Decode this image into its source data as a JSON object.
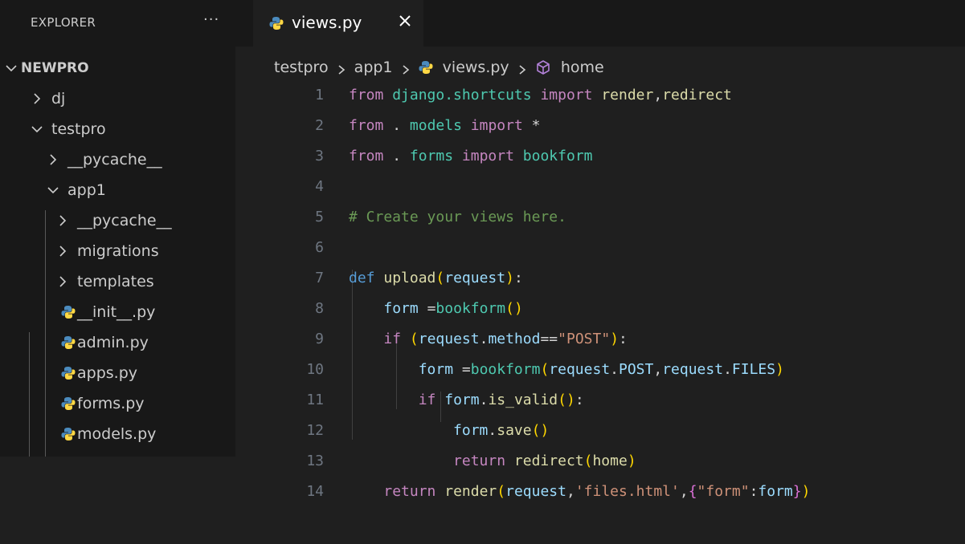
{
  "explorer": {
    "title": "EXPLORER",
    "more": "···",
    "tree": [
      {
        "label": "NEWPRO",
        "kind": "root",
        "expanded": true
      },
      {
        "label": "dj",
        "kind": "folder",
        "expanded": false
      },
      {
        "label": "testpro",
        "kind": "folder",
        "expanded": true
      },
      {
        "label": "__pycache__",
        "kind": "folder",
        "expanded": false
      },
      {
        "label": "app1",
        "kind": "folder",
        "expanded": true
      },
      {
        "label": "__pycache__",
        "kind": "folder",
        "expanded": false
      },
      {
        "label": "migrations",
        "kind": "folder",
        "expanded": false
      },
      {
        "label": "templates",
        "kind": "folder",
        "expanded": false
      },
      {
        "label": "__init__.py",
        "kind": "file",
        "icon": "python-icon"
      },
      {
        "label": "admin.py",
        "kind": "file",
        "icon": "python-icon"
      },
      {
        "label": "apps.py",
        "kind": "file",
        "icon": "python-icon"
      },
      {
        "label": "forms.py",
        "kind": "file",
        "icon": "python-icon"
      },
      {
        "label": "models.py",
        "kind": "file",
        "icon": "python-icon"
      }
    ]
  },
  "tabs": [
    {
      "label": "views.py",
      "active": true,
      "icon": "python-icon",
      "close": "close-icon"
    }
  ],
  "breadcrumbs": [
    "testpro",
    "app1",
    "views.py",
    "home"
  ],
  "code": {
    "line_numbers": [
      "1",
      "2",
      "3",
      "4",
      "5",
      "6",
      "7",
      "8",
      "9",
      "10",
      "11",
      "12",
      "13",
      "14"
    ]
  },
  "colors": {
    "sidebar_bg": "#181818",
    "editor_bg": "#1f1f1f",
    "keyword": "#c586c0",
    "def": "#569cd6",
    "function": "#dcdcaa",
    "variable": "#9cdcfe",
    "string": "#ce9178",
    "comment": "#6a9955",
    "python_icon": "#4b8bbe"
  }
}
